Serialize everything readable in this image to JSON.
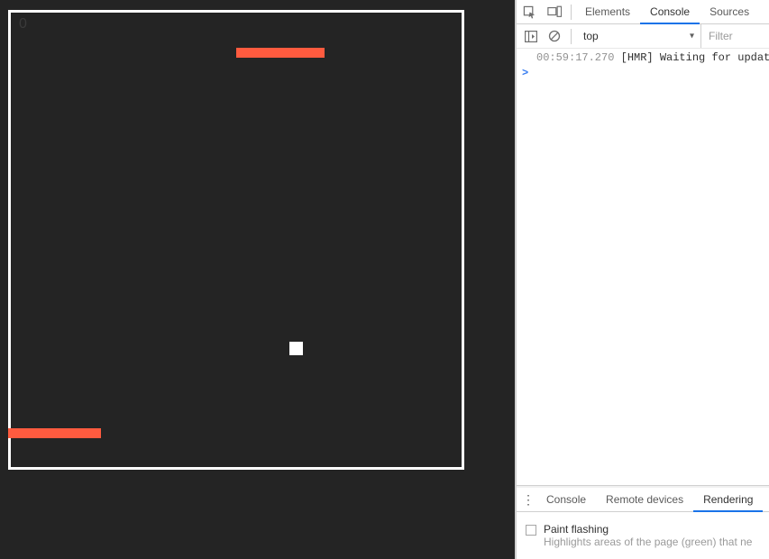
{
  "game": {
    "score": "0",
    "colors": {
      "obstacle": "#ff5b3f",
      "player": "#ffffff",
      "bg": "#242424"
    }
  },
  "tabs": {
    "elements": "Elements",
    "console": "Console",
    "sources": "Sources"
  },
  "console_toolbar": {
    "context": "top",
    "filter_placeholder": "Filter"
  },
  "console": {
    "log_timestamp": "00:59:17.270 ",
    "log_message": "[HMR] Waiting for updat",
    "prompt": ">"
  },
  "drawer": {
    "tabs": {
      "console": "Console",
      "remote": "Remote devices",
      "rendering": "Rendering"
    },
    "paint_flashing": {
      "title": "Paint flashing",
      "desc": "Highlights areas of the page (green) that ne"
    }
  }
}
